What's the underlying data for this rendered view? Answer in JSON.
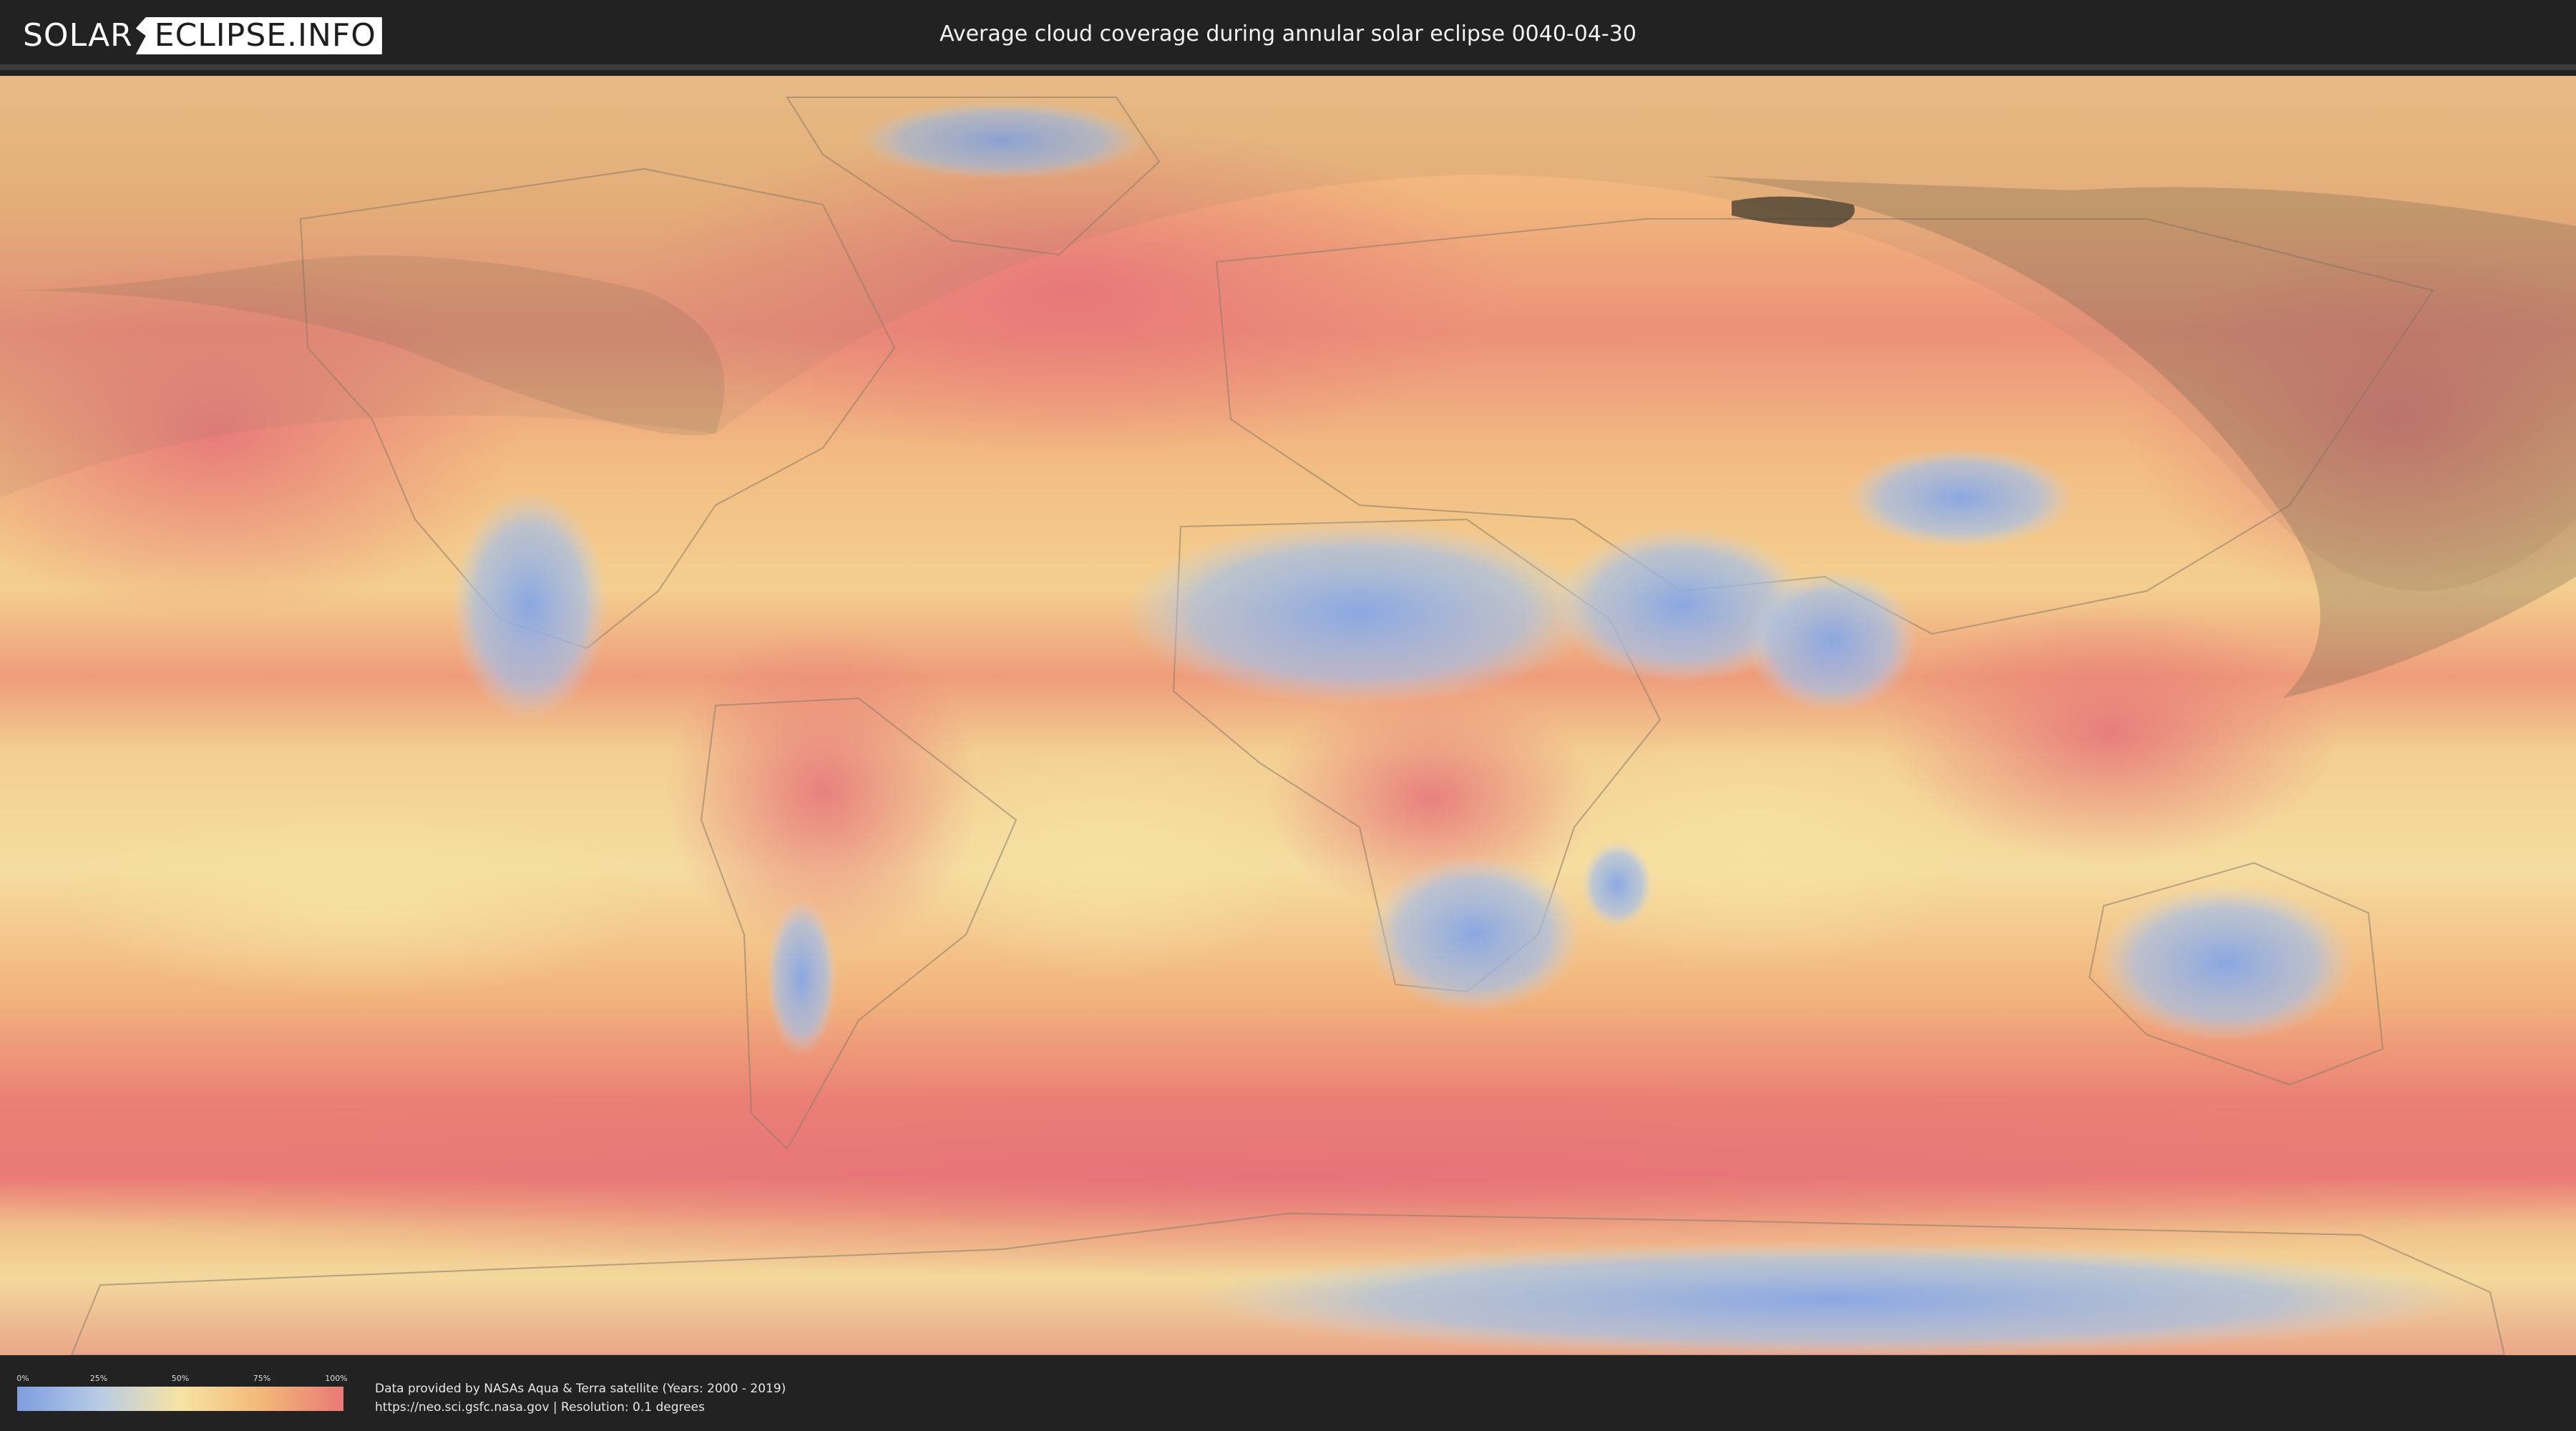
{
  "header": {
    "logo_left": "SOLAR",
    "logo_right": "ECLIPSE.INFO",
    "title": "Average cloud coverage during annular solar eclipse 0040-04-30"
  },
  "legend": {
    "labels": [
      "0%",
      "25%",
      "50%",
      "75%",
      "100%"
    ],
    "colors": [
      "#7d9ee0",
      "#b7cbe5",
      "#f6e3a3",
      "#f2b878",
      "#e97976"
    ]
  },
  "footer": {
    "credit_line_1": "Data provided by NASAs Aqua & Terra satellite (Years: 2000 - 2019)",
    "credit_line_2": "https://neo.sci.gsfc.nasa.gov | Resolution: 0.1 degrees"
  },
  "map": {
    "palette": {
      "clear": "#8aa8e4",
      "low": "#b9cde6",
      "mid": "#f5e0a0",
      "high": "#f1b376",
      "overcast": "#e97a76"
    },
    "eclipse_overlay_color": "#8a7a62",
    "annular_path_color": "#3f3a2e"
  }
}
